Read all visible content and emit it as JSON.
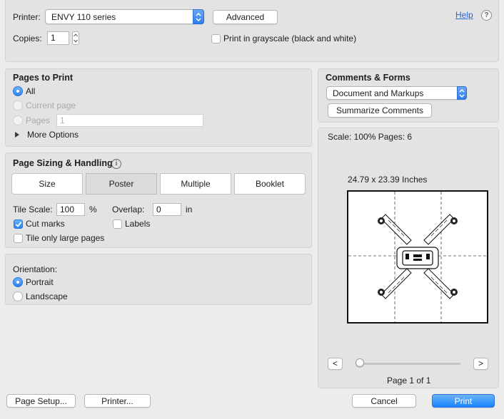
{
  "top": {
    "printer_label": "Printer:",
    "printer_value": "ENVY 110 series",
    "advanced_label": "Advanced",
    "help_link": "Help",
    "help_icon": "?",
    "copies_label": "Copies:",
    "copies_value": "1",
    "grayscale_label": "Print in grayscale (black and white)",
    "grayscale_checked": false
  },
  "pages_to_print": {
    "title": "Pages to Print",
    "all_label": "All",
    "current_label": "Current page",
    "pages_label": "Pages",
    "pages_value": "1",
    "more_options_label": "More Options",
    "selected": "All"
  },
  "sizing": {
    "title": "Page Sizing & Handling",
    "info_icon": "i",
    "tabs": [
      "Size",
      "Poster",
      "Multiple",
      "Booklet"
    ],
    "selected_tab": "Poster",
    "tile_scale_label": "Tile Scale:",
    "tile_scale_value": "100",
    "tile_scale_unit": "%",
    "overlap_label": "Overlap:",
    "overlap_value": "0",
    "overlap_unit": "in",
    "cut_marks_label": "Cut marks",
    "cut_marks_checked": true,
    "labels_label": "Labels",
    "labels_checked": false,
    "tile_large_label": "Tile only large pages",
    "tile_large_checked": false
  },
  "orientation": {
    "title": "Orientation:",
    "portrait_label": "Portrait",
    "landscape_label": "Landscape",
    "selected": "Portrait"
  },
  "comments": {
    "title": "Comments & Forms",
    "dropdown_value": "Document and Markups",
    "summarize_label": "Summarize Comments"
  },
  "preview": {
    "scale_text": "Scale: 100% Pages: 6",
    "dimensions_text": "24.79 x 23.39 Inches",
    "prev_label": "<",
    "next_label": ">",
    "page_text": "Page 1 of 1",
    "slider_position": 0
  },
  "bottom": {
    "page_setup_label": "Page Setup...",
    "printer_button_label": "Printer...",
    "cancel_label": "Cancel",
    "print_label": "Print"
  }
}
